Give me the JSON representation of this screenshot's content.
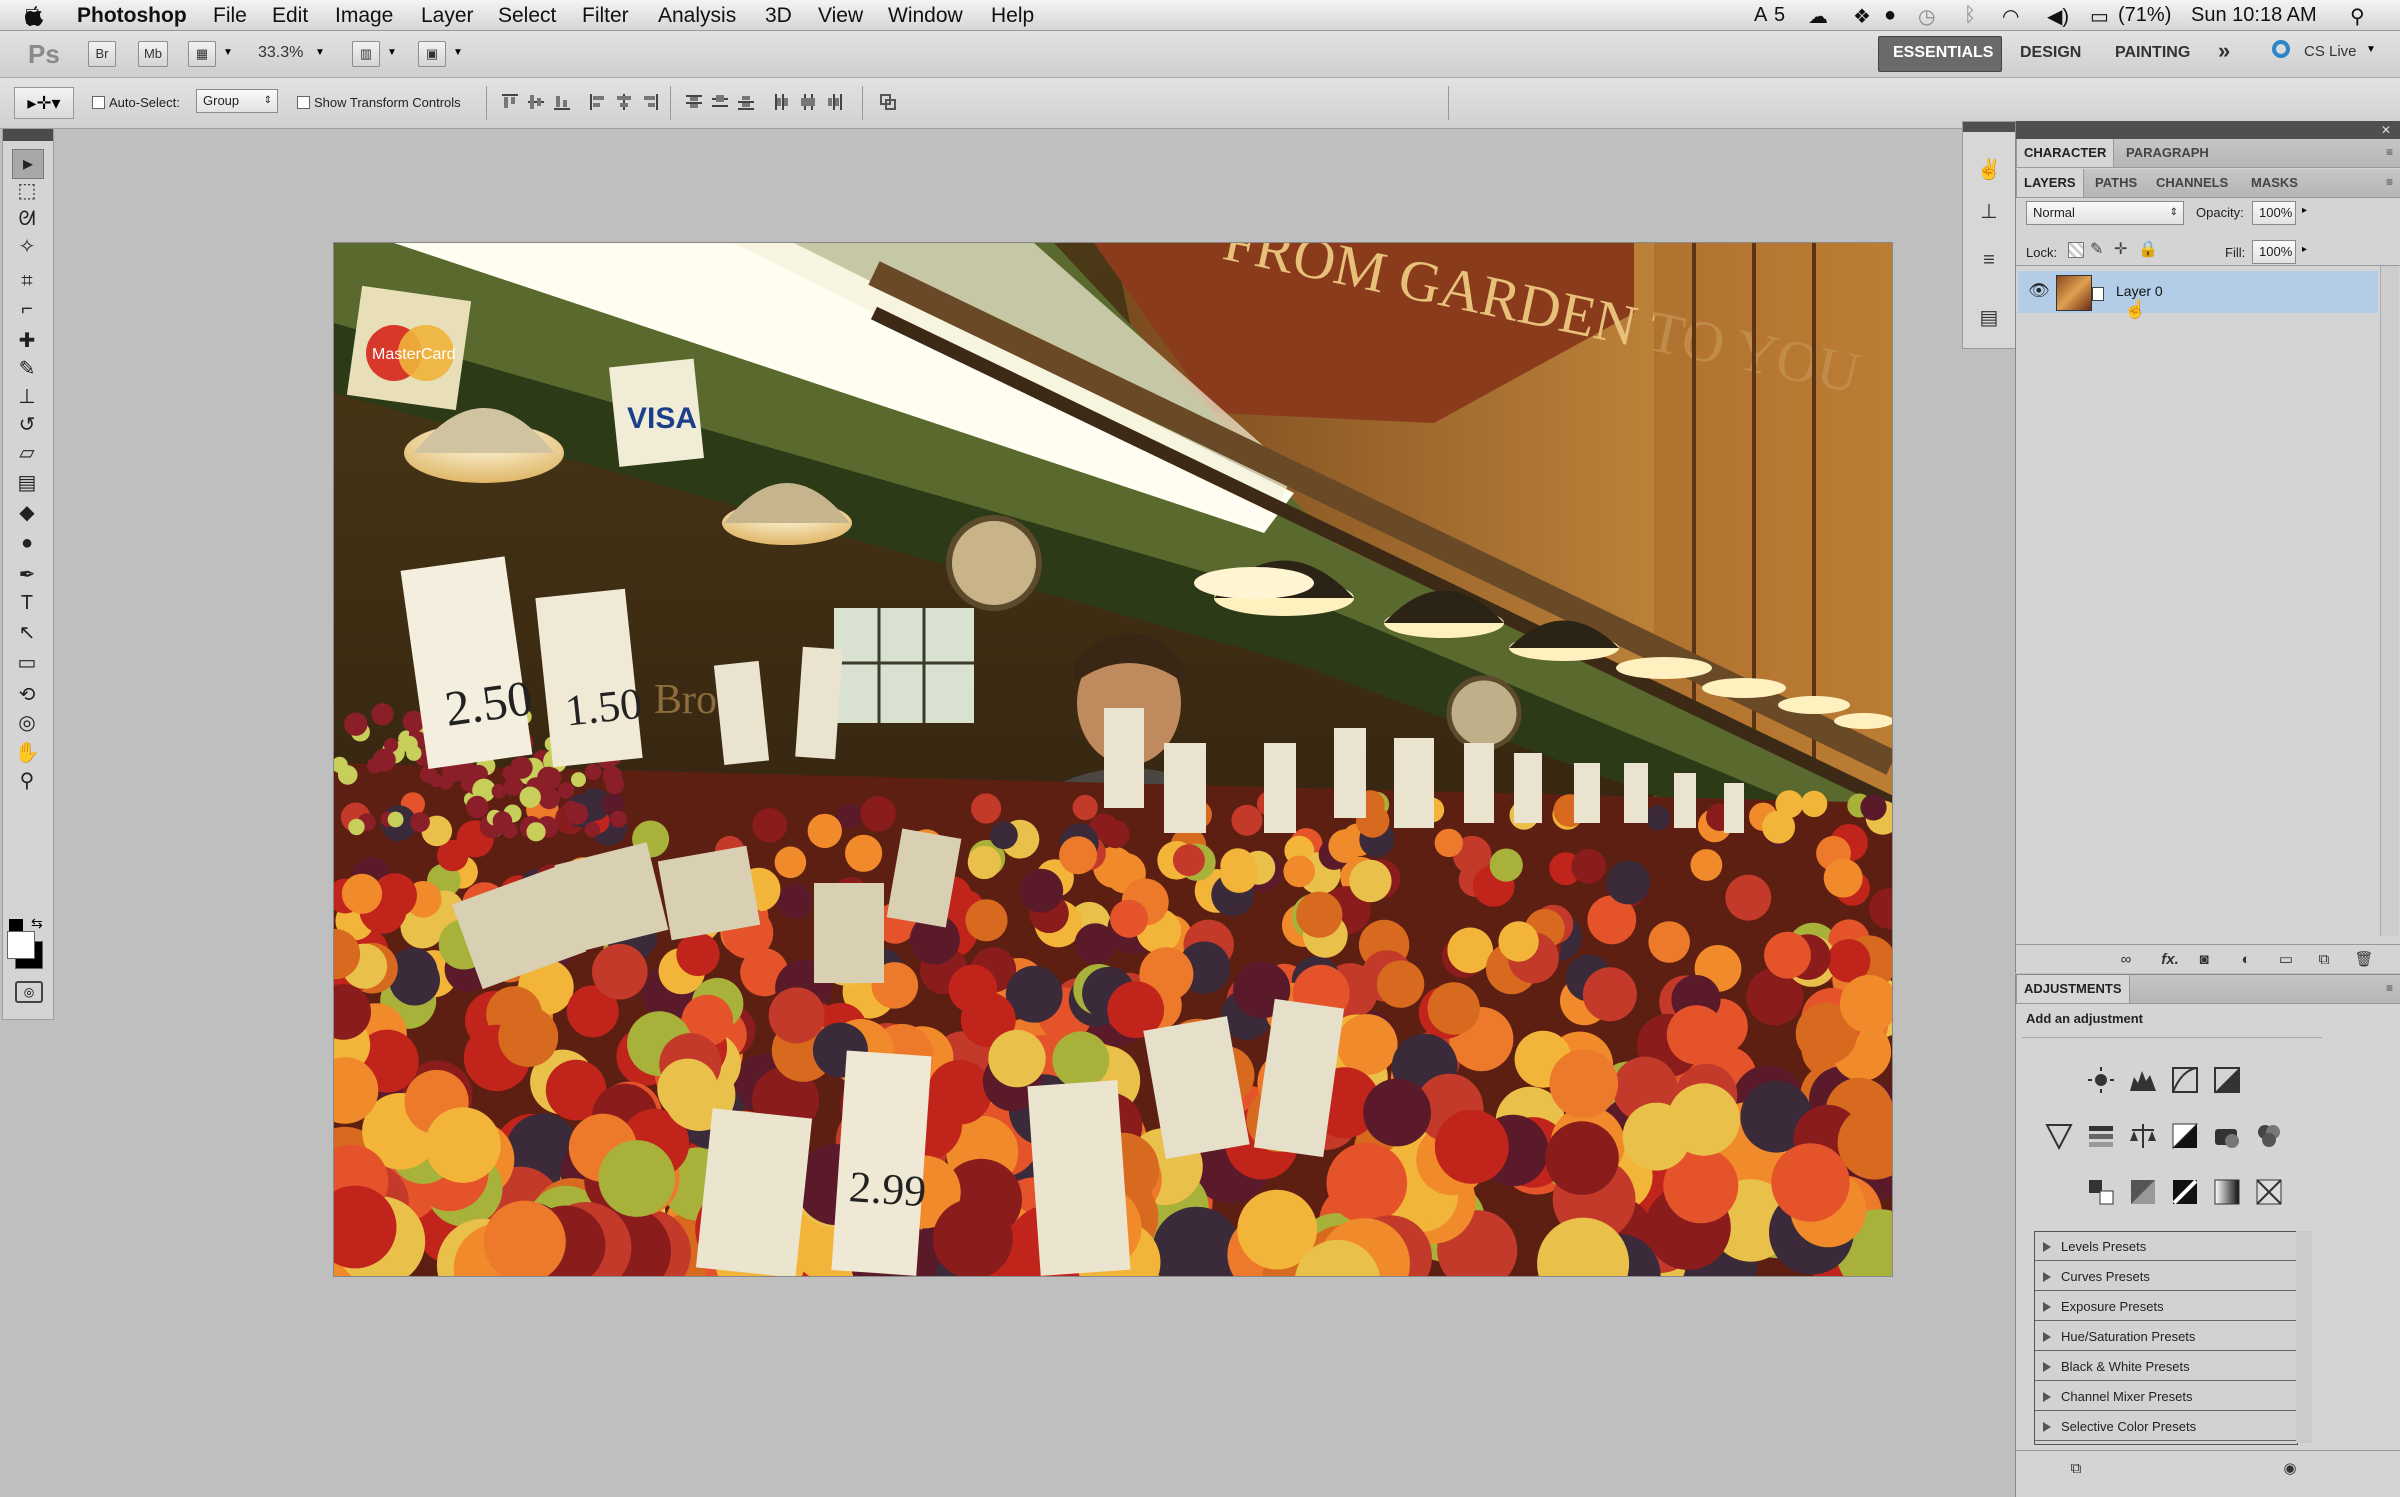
{
  "menubar": {
    "app_name": "Photoshop",
    "items": [
      "File",
      "Edit",
      "Image",
      "Layer",
      "Select",
      "Filter",
      "Analysis",
      "3D",
      "View",
      "Window",
      "Help"
    ],
    "status": {
      "adobe_badge": "5",
      "battery": "(71%)",
      "clock": "Sun 10:18 AM"
    }
  },
  "appbar": {
    "ps": "Ps",
    "br": "Br",
    "mb": "Mb",
    "zoom": "33.3%",
    "workspaces": [
      "ESSENTIALS",
      "DESIGN",
      "PAINTING"
    ],
    "more": "»",
    "cs_live": "CS Live"
  },
  "options": {
    "auto_select_label": "Auto-Select:",
    "auto_select_value": "Group",
    "transform_label": "Show Transform Controls"
  },
  "tools": [
    {
      "icon": "move-tool-icon",
      "glyph": "▸"
    },
    {
      "icon": "marquee-tool-icon",
      "glyph": "⬚"
    },
    {
      "icon": "lasso-tool-icon",
      "glyph": "ᘛ"
    },
    {
      "icon": "quick-select-tool-icon",
      "glyph": "✧"
    },
    {
      "icon": "crop-tool-icon",
      "glyph": "⌗"
    },
    {
      "icon": "eyedropper-tool-icon",
      "glyph": "⌐"
    },
    {
      "icon": "healing-brush-tool-icon",
      "glyph": "✚"
    },
    {
      "icon": "brush-tool-icon",
      "glyph": "✎"
    },
    {
      "icon": "clone-stamp-tool-icon",
      "glyph": "⊥"
    },
    {
      "icon": "history-brush-tool-icon",
      "glyph": "↺"
    },
    {
      "icon": "eraser-tool-icon",
      "glyph": "▱"
    },
    {
      "icon": "gradient-tool-icon",
      "glyph": "▤"
    },
    {
      "icon": "blur-tool-icon",
      "glyph": "◆"
    },
    {
      "icon": "dodge-tool-icon",
      "glyph": "●"
    },
    {
      "icon": "pen-tool-icon",
      "glyph": "✒"
    },
    {
      "icon": "type-tool-icon",
      "glyph": "T"
    },
    {
      "icon": "path-select-tool-icon",
      "glyph": "↖"
    },
    {
      "icon": "rectangle-tool-icon",
      "glyph": "▭"
    },
    {
      "icon": "3d-rotate-tool-icon",
      "glyph": "⟲"
    },
    {
      "icon": "3d-orbit-tool-icon",
      "glyph": "◎"
    },
    {
      "icon": "hand-tool-icon",
      "glyph": "✋"
    },
    {
      "icon": "zoom-tool-icon",
      "glyph": "⚲"
    }
  ],
  "panels": {
    "top_tabs": [
      "CHARACTER",
      "PARAGRAPH"
    ],
    "layer_tabs": [
      "LAYERS",
      "PATHS",
      "CHANNELS",
      "MASKS"
    ],
    "blend_mode": "Normal",
    "opacity_label": "Opacity:",
    "opacity_value": "100%",
    "lock_label": "Lock:",
    "fill_label": "Fill:",
    "fill_value": "100%",
    "layer_name": "Layer 0",
    "footer_fx": "fx."
  },
  "adjustments": {
    "title": "ADJUSTMENTS",
    "subtitle": "Add an adjustment",
    "presets": [
      "Levels Presets",
      "Curves Presets",
      "Exposure Presets",
      "Hue/Saturation Presets",
      "Black & White Presets",
      "Channel Mixer Presets",
      "Selective Color Presets"
    ]
  },
  "photo": {
    "sign_visa": "VISA",
    "sign_card": "MasterCard",
    "banner": "FROM GARDEN TO YOU",
    "price_1": "2.50",
    "price_2": "1.50",
    "price_3": "2.99",
    "shop_text": "Bros"
  }
}
